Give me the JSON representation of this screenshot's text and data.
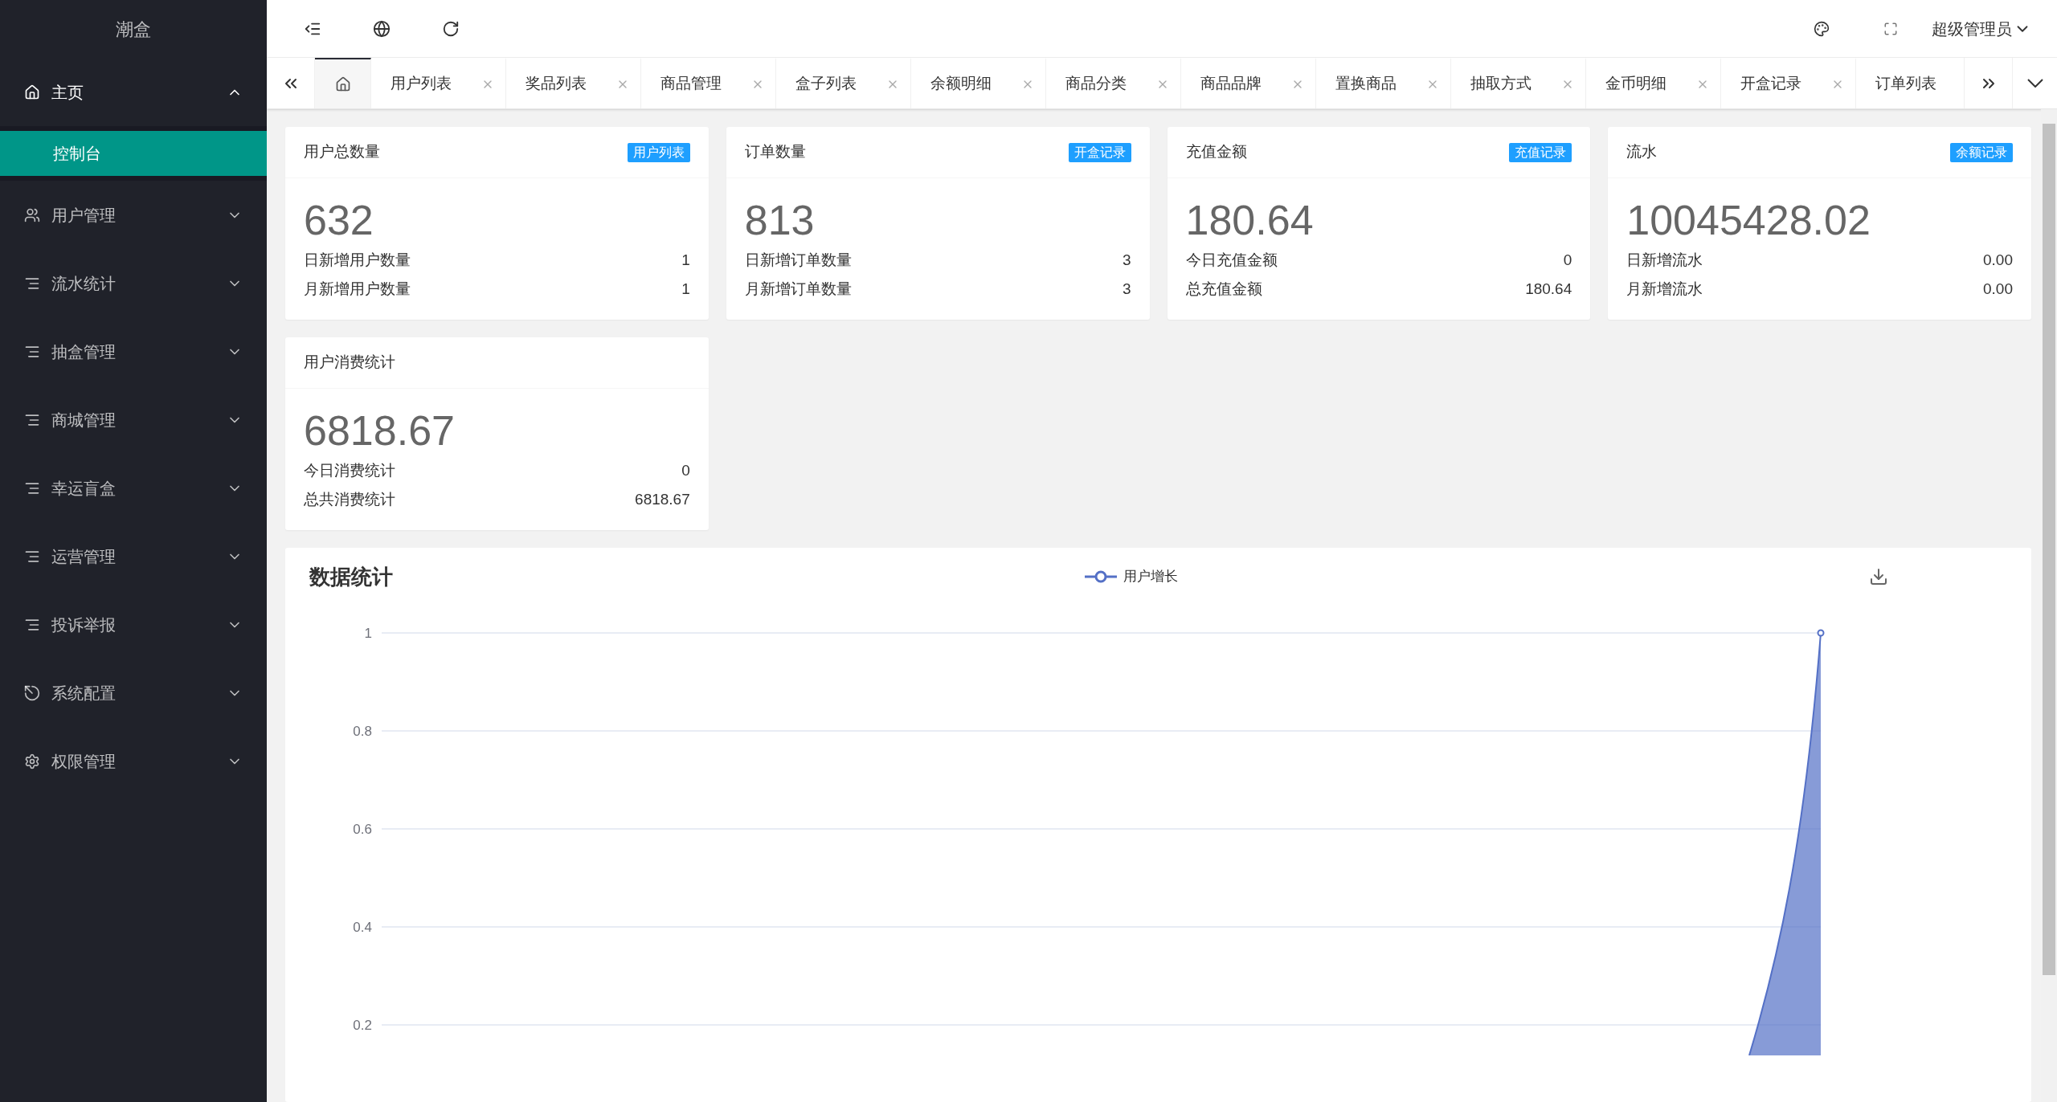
{
  "sidebar": {
    "logo": "潮盒",
    "items": [
      {
        "kind": "home",
        "label": "主页",
        "expanded": true,
        "children": [
          {
            "label": "控制台",
            "selected": true
          }
        ]
      },
      {
        "kind": "users",
        "label": "用户管理",
        "expanded": false
      },
      {
        "kind": "list",
        "label": "流水统计",
        "expanded": false
      },
      {
        "kind": "list",
        "label": "抽盒管理",
        "expanded": false
      },
      {
        "kind": "list",
        "label": "商城管理",
        "expanded": false
      },
      {
        "kind": "list",
        "label": "幸运盲盒",
        "expanded": false
      },
      {
        "kind": "list",
        "label": "运营管理",
        "expanded": false
      },
      {
        "kind": "list",
        "label": "投诉举报",
        "expanded": false
      },
      {
        "kind": "system",
        "label": "系统配置",
        "expanded": false
      },
      {
        "kind": "settings",
        "label": "权限管理",
        "expanded": false
      }
    ]
  },
  "header": {
    "user": "超级管理员"
  },
  "tabs": [
    {
      "kind": "home",
      "selected": true
    },
    {
      "kind": "page",
      "label": "用户列表",
      "selected": false
    },
    {
      "kind": "page",
      "label": "奖品列表",
      "selected": false
    },
    {
      "kind": "page",
      "label": "商品管理",
      "selected": false
    },
    {
      "kind": "page",
      "label": "盒子列表",
      "selected": false
    },
    {
      "kind": "page",
      "label": "余额明细",
      "selected": false
    },
    {
      "kind": "page",
      "label": "商品分类",
      "selected": false
    },
    {
      "kind": "page",
      "label": "商品品牌",
      "selected": false
    },
    {
      "kind": "page",
      "label": "置换商品",
      "selected": false
    },
    {
      "kind": "page",
      "label": "抽取方式",
      "selected": false
    },
    {
      "kind": "page",
      "label": "金币明细",
      "selected": false
    },
    {
      "kind": "page",
      "label": "开盒记录",
      "selected": false
    },
    {
      "kind": "page",
      "label": "订单列表",
      "selected": false
    }
  ],
  "cards": [
    {
      "title": "用户总数量",
      "badge": "用户列表",
      "value": "632",
      "rows": [
        {
          "label": "日新增用户数量",
          "value": "1"
        },
        {
          "label": "月新增用户数量",
          "value": "1"
        }
      ]
    },
    {
      "title": "订单数量",
      "badge": "开盒记录",
      "value": "813",
      "rows": [
        {
          "label": "日新增订单数量",
          "value": "3"
        },
        {
          "label": "月新增订单数量",
          "value": "3"
        }
      ]
    },
    {
      "title": "充值金额",
      "badge": "充值记录",
      "value": "180.64",
      "rows": [
        {
          "label": "今日充值金额",
          "value": "0"
        },
        {
          "label": "总充值金额",
          "value": "180.64"
        }
      ]
    },
    {
      "title": "流水",
      "badge": "余额记录",
      "value": "10045428.02",
      "rows": [
        {
          "label": "日新增流水",
          "value": "0.00"
        },
        {
          "label": "月新增流水",
          "value": "0.00"
        }
      ]
    },
    {
      "title": "用户消费统计",
      "value": "6818.67",
      "rows": [
        {
          "label": "今日消费统计",
          "value": "0"
        },
        {
          "label": "总共消费统计",
          "value": "6818.67"
        }
      ]
    }
  ],
  "stats": {
    "title": "数据统计",
    "legend": "用户增长",
    "y_axis_labels": [
      "1",
      "0.8",
      "0.6",
      "0.4",
      "0.2"
    ]
  }
}
